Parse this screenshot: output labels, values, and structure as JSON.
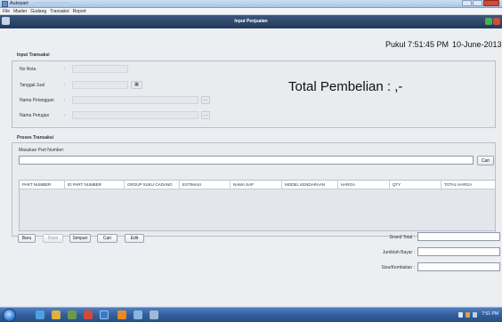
{
  "window": {
    "title": "Autopart",
    "menu": [
      "File",
      "Master",
      "Gudang",
      "Transaksi",
      "Report"
    ]
  },
  "frame": {
    "title": "Input Penjualan"
  },
  "clock": {
    "time": "Pukul 7:51:45 PM",
    "date": "10-June-2013"
  },
  "input_section": {
    "title": "Input Transaksi",
    "fields": [
      {
        "label": "No Nota",
        "value": ""
      },
      {
        "label": "Tanggal Jual",
        "value": ""
      },
      {
        "label": "Nama Pelanggan",
        "value": ""
      },
      {
        "label": "Nama Petugas",
        "value": ""
      }
    ],
    "browse_label": "..."
  },
  "total": {
    "label": "Total Pembelian : ,-"
  },
  "process_section": {
    "title": "Proses Transaksi",
    "part_label": "Masukan Part Number:",
    "part_value": "",
    "search_button": "Cari"
  },
  "table": {
    "columns": [
      "PART NUMBER",
      "ID PART NUMBER",
      "GROUP SUKU CADANG",
      "ESTIMASI",
      "NAMA SAP",
      "MODEL KENDARAAN",
      "HARGA",
      "QTY",
      "TOTAL HARGA"
    ],
    "rows": []
  },
  "actions": {
    "baru": "Baru",
    "batal": "Batal",
    "simpan": "Simpan",
    "cari": "Cari",
    "edit": "Edit"
  },
  "summary": {
    "grand_total_label": "Grand Total :",
    "jumlah_bayar_label": "Jumblah Bayar :",
    "sisa_label": "Sisa/Kembalian :",
    "grand_total": "",
    "jumlah_bayar": "",
    "sisa": ""
  },
  "taskbar": {
    "time": "7:51 PM"
  },
  "colors": {
    "frame_title_bg": "#2e476b",
    "taskbar": "#3a6aa8",
    "close_button": "#d34a3a"
  }
}
